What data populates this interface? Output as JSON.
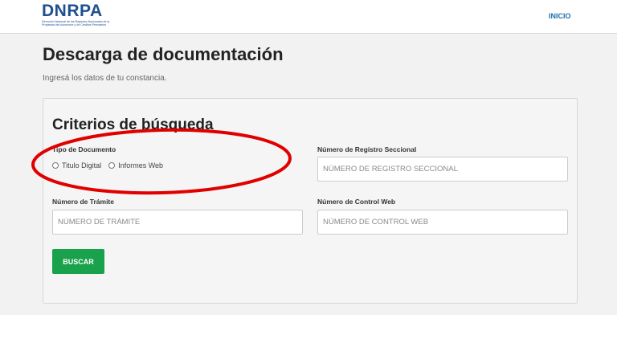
{
  "header": {
    "logo_text": "DNRPA",
    "logo_subtitle": "Dirección Nacional de los Registros Nacionales de la Propiedad del Automotor y de Créditos Prendarios",
    "nav_inicio": "INICIO"
  },
  "page": {
    "title": "Descarga de documentación",
    "subtitle": "Ingresá los datos de tu constancia."
  },
  "search": {
    "title": "Criterios de búsqueda",
    "tipo_documento_label": "Tipo de Documento",
    "tipo_options": [
      "Titulo Digital",
      "Informes Web"
    ],
    "registro_label": "Número de Registro Seccional",
    "registro_placeholder": "NÚMERO DE REGISTRO SECCIONAL",
    "tramite_label": "Número de Trámite",
    "tramite_placeholder": "NÚMERO DE TRÁMITE",
    "control_label": "Número de Control Web",
    "control_placeholder": "NÚMERO DE CONTROL WEB",
    "submit_label": "BUSCAR"
  },
  "colors": {
    "brand": "#1f4f8f",
    "nav_link": "#1a6fb0",
    "button": "#1aa14b",
    "annotation": "#e00000"
  }
}
